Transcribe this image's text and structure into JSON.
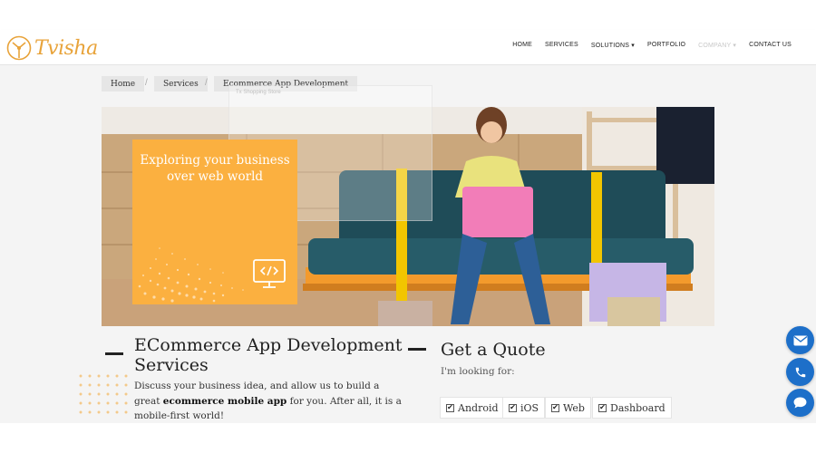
{
  "brand": {
    "name": "Tvisha",
    "color": "#e8a33a"
  },
  "nav": [
    {
      "label": "HOME",
      "dim": false
    },
    {
      "label": "SERVICES",
      "dim": false
    },
    {
      "label": "SOLUTIONS ▾",
      "dim": false
    },
    {
      "label": "PORTFOLIO",
      "dim": false
    },
    {
      "label": "COMPANY ▾",
      "dim": true
    },
    {
      "label": "CONTACT US",
      "dim": false
    }
  ],
  "breadcrumb": {
    "home": "Home",
    "services": "Services",
    "current": "Ecommerce App Development",
    "separator": "/"
  },
  "ghost_overlay": {
    "text": "Tx Shopping Store"
  },
  "hero": {
    "card_text": "Exploring your business over web world",
    "accent": "#fbb040"
  },
  "main": {
    "title": "ECommerce App Development Services",
    "para_before": "Discuss your business idea, and allow us to build a great ",
    "para_bold": "ecommerce mobile app",
    "para_after": " for you. After all, it is a mobile-first world!"
  },
  "quote": {
    "title": "Get a Quote",
    "looking_for": "I'm looking for:",
    "options": [
      {
        "label": "Android",
        "checked": true
      },
      {
        "label": "iOS",
        "checked": true
      },
      {
        "label": "Web",
        "checked": true
      },
      {
        "label": "Dashboard",
        "checked": true
      }
    ]
  },
  "floating_actions": [
    {
      "icon": "mail-icon"
    },
    {
      "icon": "phone-icon"
    },
    {
      "icon": "chat-icon"
    }
  ],
  "colors": {
    "fab": "#1d6fc9",
    "content_bg": "#f4f4f4"
  }
}
